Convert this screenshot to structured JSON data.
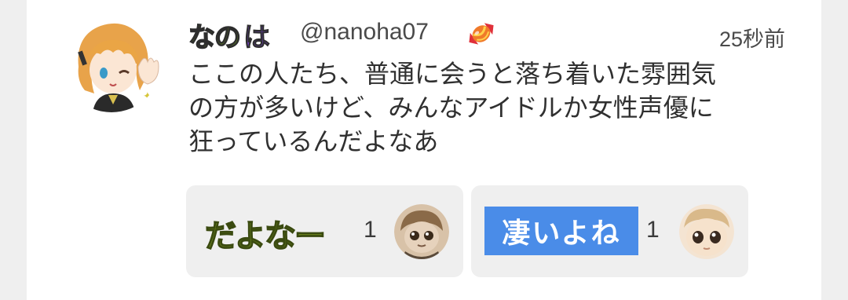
{
  "post": {
    "display_name_part1": "なの",
    "display_name_part2": "は",
    "handle": "@nanoha07",
    "badge_icon": "candy-icon",
    "timestamp": "25秒前",
    "text": "ここの人たち、普通に会うと落ち着いた雰囲気\nの方が多いけど、みんなアイドルか女性声優に\n狂っているんだよなあ"
  },
  "reactions": [
    {
      "emoji_text": "だよなー",
      "count": "1",
      "reactor_icon": "reactor-avatar-1"
    },
    {
      "emoji_text": "凄いよね",
      "count": "1",
      "reactor_icon": "reactor-avatar-2"
    }
  ],
  "colors": {
    "name_green": "#7cb21c",
    "name_purple": "#6a3fb0",
    "reaction_bg": "#efefef",
    "sugoi_blue": "#4a8ce8",
    "dayona_green": "#7d9a22"
  }
}
